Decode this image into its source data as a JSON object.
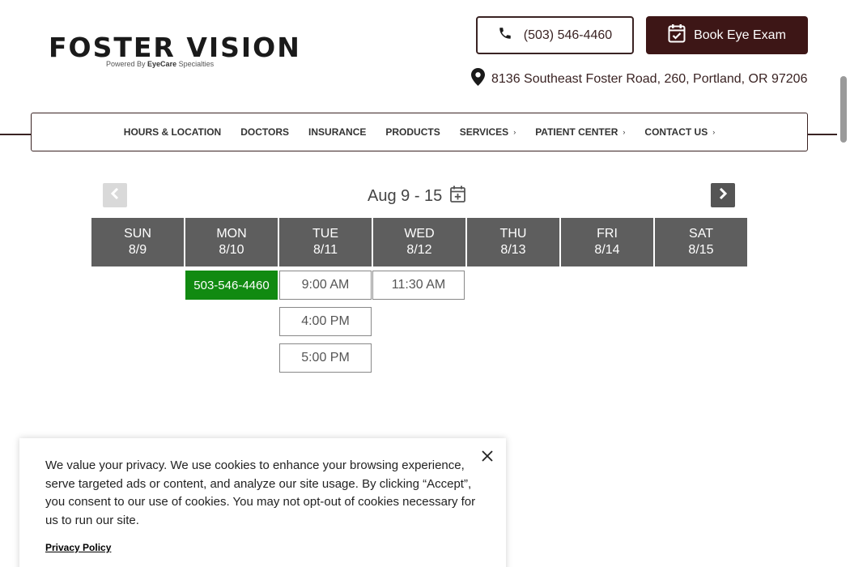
{
  "brand": {
    "name": "FOSTER VISION",
    "tagline_prefix": "Powered By",
    "tagline_brand": "EyeCare",
    "tagline_suffix": "Specialties"
  },
  "header": {
    "phone_label": "(503) 546-4460",
    "book_label": "Book Eye Exam",
    "address": "8136 Southeast Foster Road, 260, Portland, OR 97206"
  },
  "nav": {
    "items": [
      {
        "label": "HOURS & LOCATION",
        "has_submenu": false
      },
      {
        "label": "DOCTORS",
        "has_submenu": false
      },
      {
        "label": "INSURANCE",
        "has_submenu": false
      },
      {
        "label": "PRODUCTS",
        "has_submenu": false
      },
      {
        "label": "SERVICES",
        "has_submenu": true
      },
      {
        "label": "PATIENT CENTER",
        "has_submenu": true
      },
      {
        "label": "CONTACT US",
        "has_submenu": true
      }
    ]
  },
  "scheduler": {
    "week_label": "Aug 9 - 15",
    "days": [
      {
        "name": "SUN",
        "date": "8/9"
      },
      {
        "name": "MON",
        "date": "8/10"
      },
      {
        "name": "TUE",
        "date": "8/11"
      },
      {
        "name": "WED",
        "date": "8/12"
      },
      {
        "name": "THU",
        "date": "8/13"
      },
      {
        "name": "FRI",
        "date": "8/14"
      },
      {
        "name": "SAT",
        "date": "8/15"
      }
    ],
    "slots": {
      "mon_phone": "503-546-4460",
      "tue": [
        "9:00 AM",
        "4:00 PM",
        "5:00 PM"
      ],
      "wed": [
        "11:30 AM"
      ]
    }
  },
  "cookie": {
    "text": "We value your privacy. We use cookies to enhance your browsing experience, serve targeted ads or content, and analyze our site usage. By clicking “Accept”, you consent to our use of cookies. You may not opt-out of cookies necessary for us to run our site.",
    "privacy_link": "Privacy Policy"
  },
  "colors": {
    "brand_dark": "#3d1616",
    "day_header": "#5e5e5e",
    "available_green": "#118a11"
  },
  "icons": [
    "phone-icon",
    "calendar-check-icon",
    "map-pin-icon",
    "chevron-left-icon",
    "chevron-right-icon",
    "calendar-plus-icon",
    "close-icon"
  ]
}
